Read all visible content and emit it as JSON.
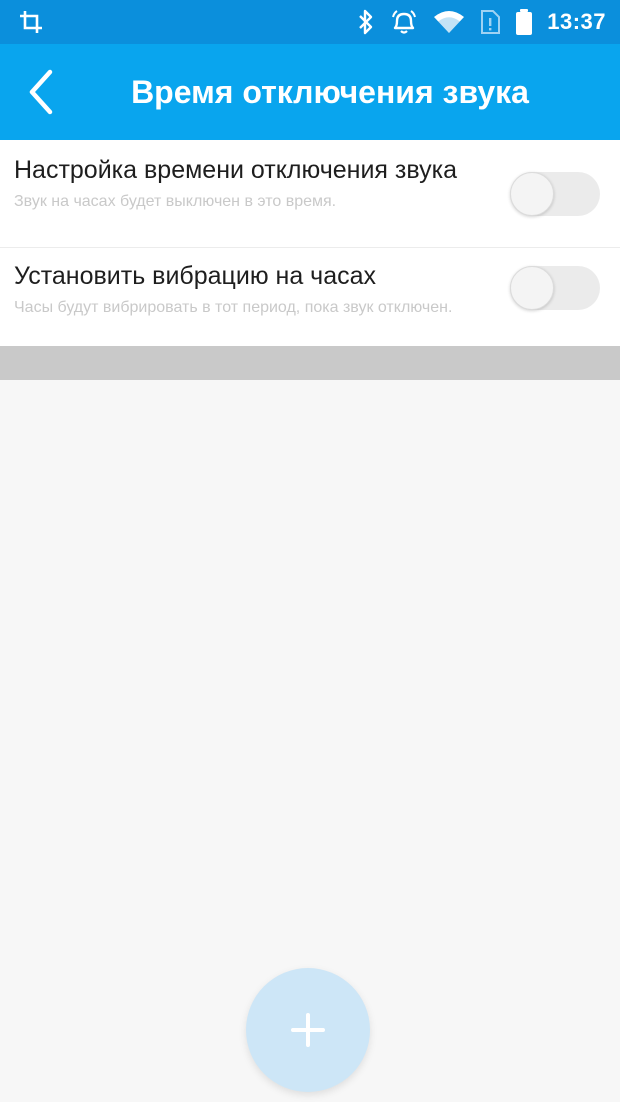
{
  "status_bar": {
    "time": "13:37",
    "icons": [
      "screenshot-icon",
      "bluetooth-icon",
      "alarm-icon",
      "wifi-icon",
      "sim-icon",
      "battery-icon"
    ]
  },
  "app_bar": {
    "title": "Время отключения звука",
    "back_icon": "chevron-left-icon"
  },
  "settings": [
    {
      "title": "Настройка времени отключения звука",
      "subtitle": "Звук на часах будет выключен в это время.",
      "enabled": false
    },
    {
      "title": "Установить вибрацию на часах",
      "subtitle": "Часы будут вибрировать в тот период, пока звук отключен.",
      "enabled": false
    }
  ],
  "fab": {
    "icon": "plus-icon"
  },
  "colors": {
    "status_bar": "#0b8fdc",
    "app_bar": "#09a5ee",
    "background": "#f7f7f7",
    "separator": "#c9c9c9",
    "fab": "#cde6f7"
  }
}
